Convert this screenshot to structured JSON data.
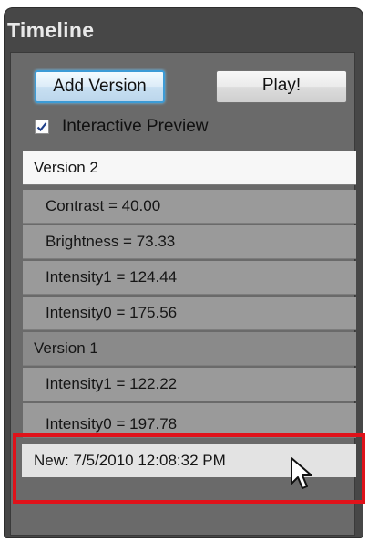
{
  "panel": {
    "title": "Timeline"
  },
  "toolbar": {
    "add_version_label": "Add Version",
    "play_label": "Play!"
  },
  "interactive_preview": {
    "label": "Interactive Preview",
    "checked": true
  },
  "tree": [
    {
      "label": "Version 2",
      "kind": "version",
      "selected": true
    },
    {
      "label": "Contrast = 40.00",
      "kind": "param"
    },
    {
      "label": "Brightness = 73.33",
      "kind": "param"
    },
    {
      "label": "Intensity1 = 124.44",
      "kind": "param"
    },
    {
      "label": "Intensity0 = 175.56",
      "kind": "param"
    },
    {
      "label": "Version 1",
      "kind": "version"
    },
    {
      "label": "Intensity1 = 122.22",
      "kind": "param"
    },
    {
      "label": "Intensity0 = 197.78",
      "kind": "param"
    },
    {
      "label": "New: 7/5/2010 12:08:32 PM",
      "kind": "new"
    }
  ],
  "icons": {
    "checkbox": "checkmark-icon",
    "pointer": "mouse-pointer-icon"
  },
  "colors": {
    "highlight": "#e0121a",
    "panel_bg": "#474747",
    "selected_row": "#f7f7f7"
  }
}
